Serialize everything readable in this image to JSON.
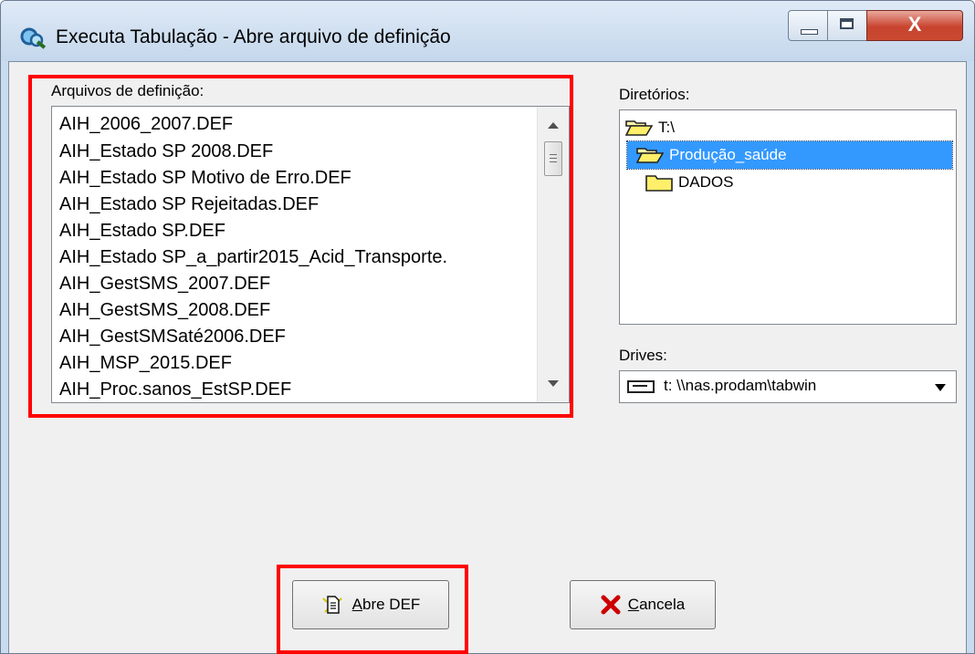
{
  "window": {
    "title": "Executa Tabulação - Abre arquivo de definição",
    "icon": "tabwin-magnifier-icon",
    "close_glyph": "X"
  },
  "files": {
    "label": "Arquivos de definição:",
    "items": [
      "AIH_2006_2007.DEF",
      "AIH_Estado SP 2008.DEF",
      "AIH_Estado SP Motivo de Erro.DEF",
      "AIH_Estado SP Rejeitadas.DEF",
      "AIH_Estado SP.DEF",
      "AIH_Estado SP_a_partir2015_Acid_Transporte.",
      "AIH_GestSMS_2007.DEF",
      "AIH_GestSMS_2008.DEF",
      "AIH_GestSMSaté2006.DEF",
      "AIH_MSP_2015.DEF",
      "AIH_Proc.sanos_EstSP.DEF"
    ]
  },
  "dirs": {
    "label": "Diretórios:",
    "items": [
      {
        "label": "T:\\",
        "icon": "open-folder-icon"
      },
      {
        "label": "Produção_saúde",
        "icon": "open-folder-icon",
        "selected": true
      },
      {
        "label": "DADOS",
        "icon": "folder-icon"
      }
    ]
  },
  "drives": {
    "label": "Drives:",
    "selected": "t: \\\\nas.prodam\\tabwin",
    "icon": "network-drive-icon"
  },
  "buttons": {
    "open": {
      "accel": "A",
      "rest": "bre DEF",
      "icon": "file-open-icon"
    },
    "cancel": {
      "accel": "C",
      "rest": "ancela",
      "icon": "red-x-icon"
    }
  },
  "colors": {
    "highlight": "#ff0000",
    "selection": "#3399ff",
    "close_button": "#c8432e",
    "cancel_x": "#cc0000"
  }
}
